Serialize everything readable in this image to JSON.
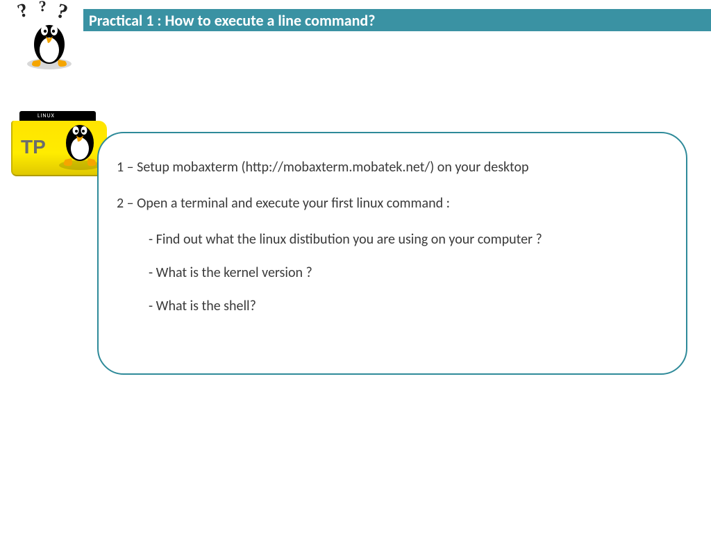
{
  "header": {
    "title": "Practical 1 : How to execute a line command?"
  },
  "folder": {
    "tab_text": "LINUX",
    "label": "TP"
  },
  "content": {
    "step1": "1 – Setup mobaxterm (http://mobaxterm.mobatek.net/) on your desktop",
    "step2": "2 – Open a terminal and execute your first linux command :",
    "sub1": "- Find out what the linux distibution you are using on your computer ?",
    "sub2": "- What is the kernel version ?",
    "sub3": "- What  is the shell?"
  }
}
